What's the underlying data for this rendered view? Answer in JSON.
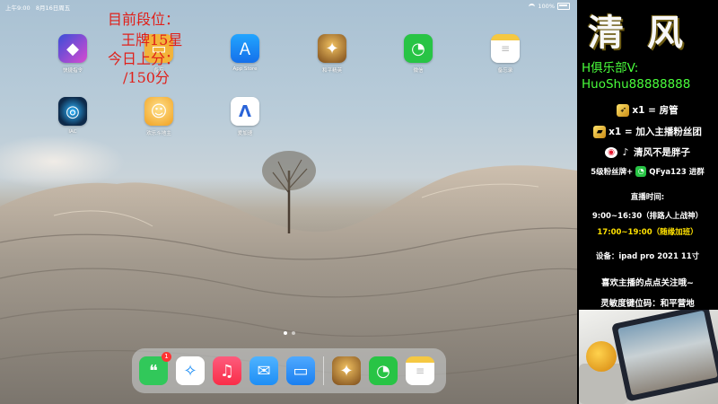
{
  "status_bar": {
    "time": "上午9:00",
    "date": "8月16日周五",
    "battery": "100%"
  },
  "overlay": {
    "rank_label": "目前段位：",
    "rank_value": "王牌15星",
    "score_label": "今日上分：",
    "score_value": "/150分"
  },
  "apps": [
    {
      "name": "快捷指令",
      "icon": "shortcuts-icon",
      "color": "#3a4ed8"
    },
    {
      "name": "备忘",
      "icon": "folder-icon",
      "color": "#f2b33a"
    },
    {
      "name": "App Store",
      "icon": "app-store-icon",
      "color": "#1a8cf0"
    },
    {
      "name": "和平精英",
      "icon": "peacekeeper-elite-icon",
      "color": "#7a4a1a"
    },
    {
      "name": "微信",
      "icon": "wechat-icon",
      "color": "#28c445"
    },
    {
      "name": "备忘录",
      "icon": "notes-icon",
      "color": "#ffffff"
    },
    {
      "name": "IAC",
      "icon": "iac-icon",
      "color": "#0e2a4a"
    },
    {
      "name": "欢乐斗地主",
      "icon": "landlord-game-icon",
      "color": "#f0a020"
    },
    {
      "name": "爱加速",
      "icon": "accelerator-icon",
      "color": "#ffffff"
    }
  ],
  "dock": [
    {
      "icon": "messages-icon",
      "color": "#31c85a",
      "badge": "1"
    },
    {
      "icon": "safari-icon",
      "color": "#ffffff"
    },
    {
      "icon": "music-icon",
      "color": "#fa2d48"
    },
    {
      "icon": "mail-icon",
      "color": "#1e8ef5"
    },
    {
      "icon": "files-icon",
      "color": "#1a7ff0"
    },
    {
      "icon": "peacekeeper-elite-icon",
      "color": "#7a4a1a"
    },
    {
      "icon": "wechat-icon",
      "color": "#28c445"
    },
    {
      "icon": "notes-icon",
      "color": "#ffffff"
    }
  ],
  "panel": {
    "title": "清风",
    "club_label": "H俱乐部V:",
    "club_id": "HuoShu88888888",
    "gift1": "x1 = 房管",
    "gift2": "x1 = 加入主播粉丝团",
    "social_name": "清风不是胖子",
    "fan_level": "5级粉丝牌+",
    "group": "QFya123 进群",
    "hours_title": "直播时间:",
    "hours_main": "9:00~16:30（排路人上战神）",
    "hours_extra": "17:00~19:00（随缘加班）",
    "device": "设备：ipad pro 2021 11寸",
    "follow": "喜欢主播的点点关注哦~",
    "sensitivity": "灵敏度键位码：和平营地"
  }
}
